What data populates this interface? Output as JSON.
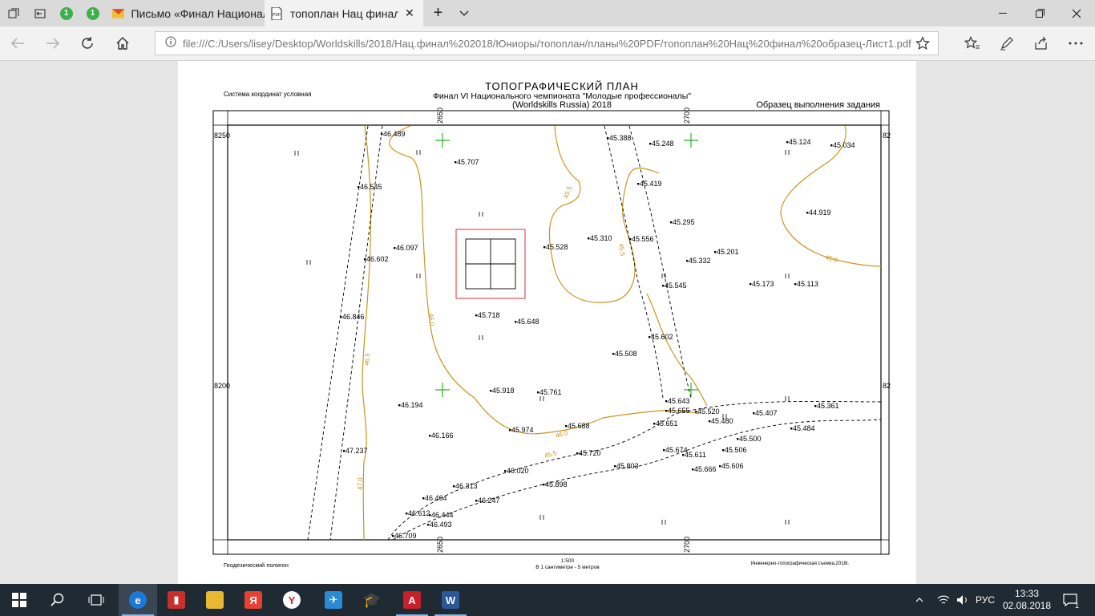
{
  "browser": {
    "tabs": [
      {
        "label": "Письмо «Финал Национал",
        "icon": "mail-icon"
      },
      {
        "label": "топоплан Нац финал с",
        "icon": "pdf-icon"
      }
    ],
    "pinned_tab_badge": "1",
    "new_tab_symbol": "+",
    "address_url": "file:///C:/Users/lisey/Desktop/Worldskills/2018/Нац.финал%202018/Юниоры/топоплан/планы%20PDF/топоплан%20Нац%20финал%20образец-Лист1.pdf"
  },
  "doc": {
    "coord_system": "Система координат условная",
    "title": "ТОПОГРАФИЧЕСКИЙ ПЛАН",
    "subtitle1": "Финал VI Национального чемпионата \"Молодые профессионалы\"",
    "subtitle2": "(Worldskills Russia) 2018",
    "sample_note": "Образец выполнения задания",
    "footer_left": "Геодезический полигон",
    "scale": "1:500",
    "scale_note": "В 1 сантиметре - 5 метров",
    "footer_right": "Инженерно-топографическая съемка,2018г.",
    "grid_labels": {
      "left_top": "8250",
      "left_bottom": "8200",
      "right_top": "82",
      "right_bottom": "82",
      "top1": "2650",
      "top2": "2700",
      "bottom1": "2650",
      "bottom2": "2700"
    },
    "contour_labels": [
      "45.5",
      "45.5",
      "45.0",
      "46.0",
      "46.5",
      "47.0",
      "46.0",
      "45.5"
    ],
    "points": [
      {
        "v": "46.489"
      },
      {
        "v": "45.707"
      },
      {
        "v": "45.388"
      },
      {
        "v": "45.248"
      },
      {
        "v": "45.124"
      },
      {
        "v": "45.034"
      },
      {
        "v": "46.545"
      },
      {
        "v": "45.419"
      },
      {
        "v": "45.295"
      },
      {
        "v": "44.919"
      },
      {
        "v": "46.097"
      },
      {
        "v": "46.602"
      },
      {
        "v": "45.528"
      },
      {
        "v": "45.310"
      },
      {
        "v": "45.556"
      },
      {
        "v": "45.332"
      },
      {
        "v": "45.201"
      },
      {
        "v": "45.545"
      },
      {
        "v": "45.173"
      },
      {
        "v": "45.113"
      },
      {
        "v": "46.846"
      },
      {
        "v": "45.718"
      },
      {
        "v": "45.648"
      },
      {
        "v": "45.602"
      },
      {
        "v": "45.508"
      },
      {
        "v": "45.918"
      },
      {
        "v": "45.761"
      },
      {
        "v": "45.643"
      },
      {
        "v": "45.655"
      },
      {
        "v": "45.520"
      },
      {
        "v": "46.194"
      },
      {
        "v": "45.480"
      },
      {
        "v": "45.407"
      },
      {
        "v": "45.361"
      },
      {
        "v": "45.974"
      },
      {
        "v": "45.688"
      },
      {
        "v": "45.651"
      },
      {
        "v": "46.166"
      },
      {
        "v": "45.500"
      },
      {
        "v": "45.484"
      },
      {
        "v": "47.237"
      },
      {
        "v": "45.720"
      },
      {
        "v": "45.674"
      },
      {
        "v": "45.611"
      },
      {
        "v": "45.506"
      },
      {
        "v": "45.803"
      },
      {
        "v": "46.020"
      },
      {
        "v": "45.666"
      },
      {
        "v": "45.606"
      },
      {
        "v": "46.313"
      },
      {
        "v": "45.898"
      },
      {
        "v": "46.464"
      },
      {
        "v": "46.247"
      },
      {
        "v": "46.612"
      },
      {
        "v": "46.444"
      },
      {
        "v": "46.493"
      },
      {
        "v": "46.709"
      }
    ]
  },
  "taskbar": {
    "time": "13:33",
    "date": "02.08.2018",
    "lang": "РУС",
    "notif_count": "1"
  }
}
